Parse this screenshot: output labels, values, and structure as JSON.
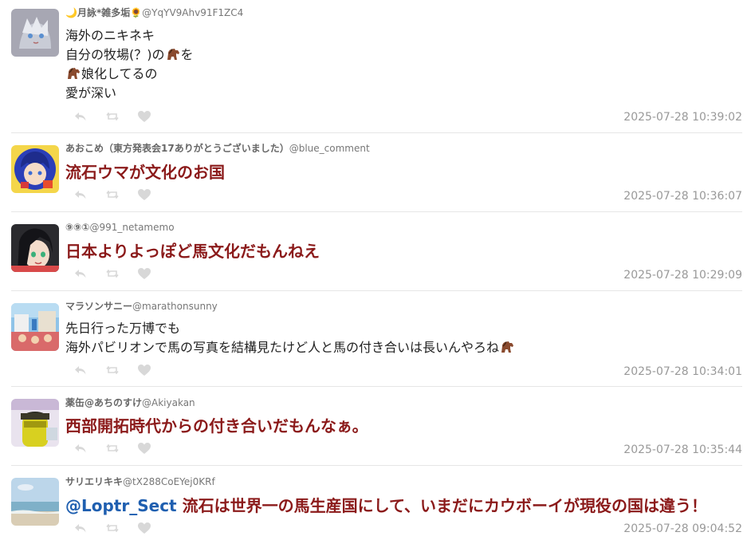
{
  "posts": [
    {
      "name": "🌙月詠*雑多垢🌻",
      "handle": "@YqYV9Ahv91F1ZC4",
      "lines": [
        "海外のニキネキ",
        "自分の牧場(？)の",
        "を",
        "娘化してるの",
        "愛が深い"
      ],
      "timestamp": "2025-07-28 10:39:02",
      "avatar": "gray-haired-character"
    },
    {
      "name": "あおこめ（東方発表会17ありがとうございました）",
      "handle": "@blue_comment",
      "text": "流石ウマが文化のお国",
      "timestamp": "2025-07-28 10:36:07",
      "avatar": "blue-haired-character"
    },
    {
      "name": "⑨⑨①",
      "handle": "@991_netamemo",
      "text": "日本よりよっぽど馬文化だもんねえ",
      "timestamp": "2025-07-28 10:29:09",
      "avatar": "black-haired-character"
    },
    {
      "name": "マラソンサニー",
      "handle": "@marathonsunny",
      "line1": "先日行った万博でも",
      "line2": "海外パビリオンで馬の写真を結構見たけど人と馬の付き合いは長いんやろね",
      "timestamp": "2025-07-28 10:34:01",
      "avatar": "expo-photo"
    },
    {
      "name": "薬缶@あちのすけ",
      "handle": "@Akiyakan",
      "text": "西部開拓時代からの付き合いだもんなぁ。",
      "timestamp": "2025-07-28 10:35:44",
      "avatar": "yellow-figure-photo"
    },
    {
      "name": "サリエリキキ",
      "handle": "@tX288CoEYej0KRf",
      "mention": "@Loptr_Sect",
      "text": " 流石は世界一の馬生産国にして、いまだにカウボーイが現役の国は違う！",
      "timestamp": "2025-07-28 09:04:52",
      "avatar": "beach-photo"
    }
  ],
  "icons": {
    "reply": "reply-icon",
    "retweet": "retweet-icon",
    "like": "heart-icon",
    "horse": "horse-emoji-icon"
  },
  "colors": {
    "big_text": "#8b1a1a",
    "mention": "#1f5fb0",
    "timestamp": "#999999",
    "action_icons": "#d8d8d8"
  }
}
